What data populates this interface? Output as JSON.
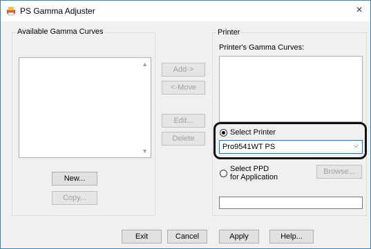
{
  "window": {
    "title": "PS Gamma Adjuster",
    "close_glyph": "×"
  },
  "available": {
    "group_label": "Available Gamma Curves",
    "new_label": "New...",
    "copy_label": "Copy..."
  },
  "middle": {
    "add_label": "Add->",
    "move_label": "<-Move",
    "edit_label": "Edit...",
    "delete_label": "Delete"
  },
  "printer": {
    "group_label": "Printer",
    "curves_label": "Printer's Gamma Curves:",
    "select_printer_label": "Select Printer",
    "selected_printer": "Pro9541WT PS",
    "select_ppd_line1": "Select PPD",
    "select_ppd_line2": "for Application",
    "browse_label": "Browse...",
    "ppd_path": ""
  },
  "footer": {
    "exit_label": "Exit",
    "cancel_label": "Cancel",
    "apply_label": "Apply",
    "help_label": "Help..."
  },
  "colors": {
    "accent": "#0078d7",
    "highlight_border": "#111111"
  }
}
